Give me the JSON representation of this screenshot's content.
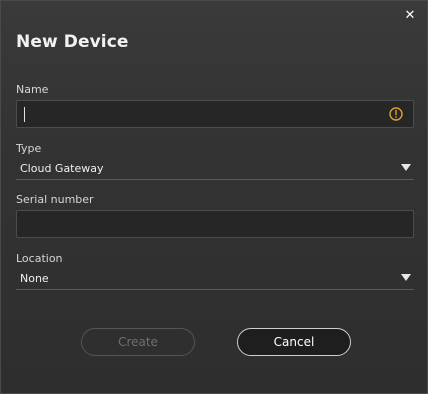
{
  "dialog": {
    "title": "New Device",
    "close_glyph": "✕"
  },
  "fields": {
    "name": {
      "label": "Name",
      "value": "",
      "icon": "info-icon"
    },
    "type": {
      "label": "Type",
      "value": "Cloud Gateway",
      "icon": "chevron-down-icon"
    },
    "serial": {
      "label": "Serial number",
      "value": ""
    },
    "location": {
      "label": "Location",
      "value": "None",
      "icon": "chevron-down-icon"
    }
  },
  "buttons": {
    "create": "Create",
    "cancel": "Cancel"
  },
  "colors": {
    "accent": "#e0a030",
    "disabled_text": "#6f6f6f"
  }
}
